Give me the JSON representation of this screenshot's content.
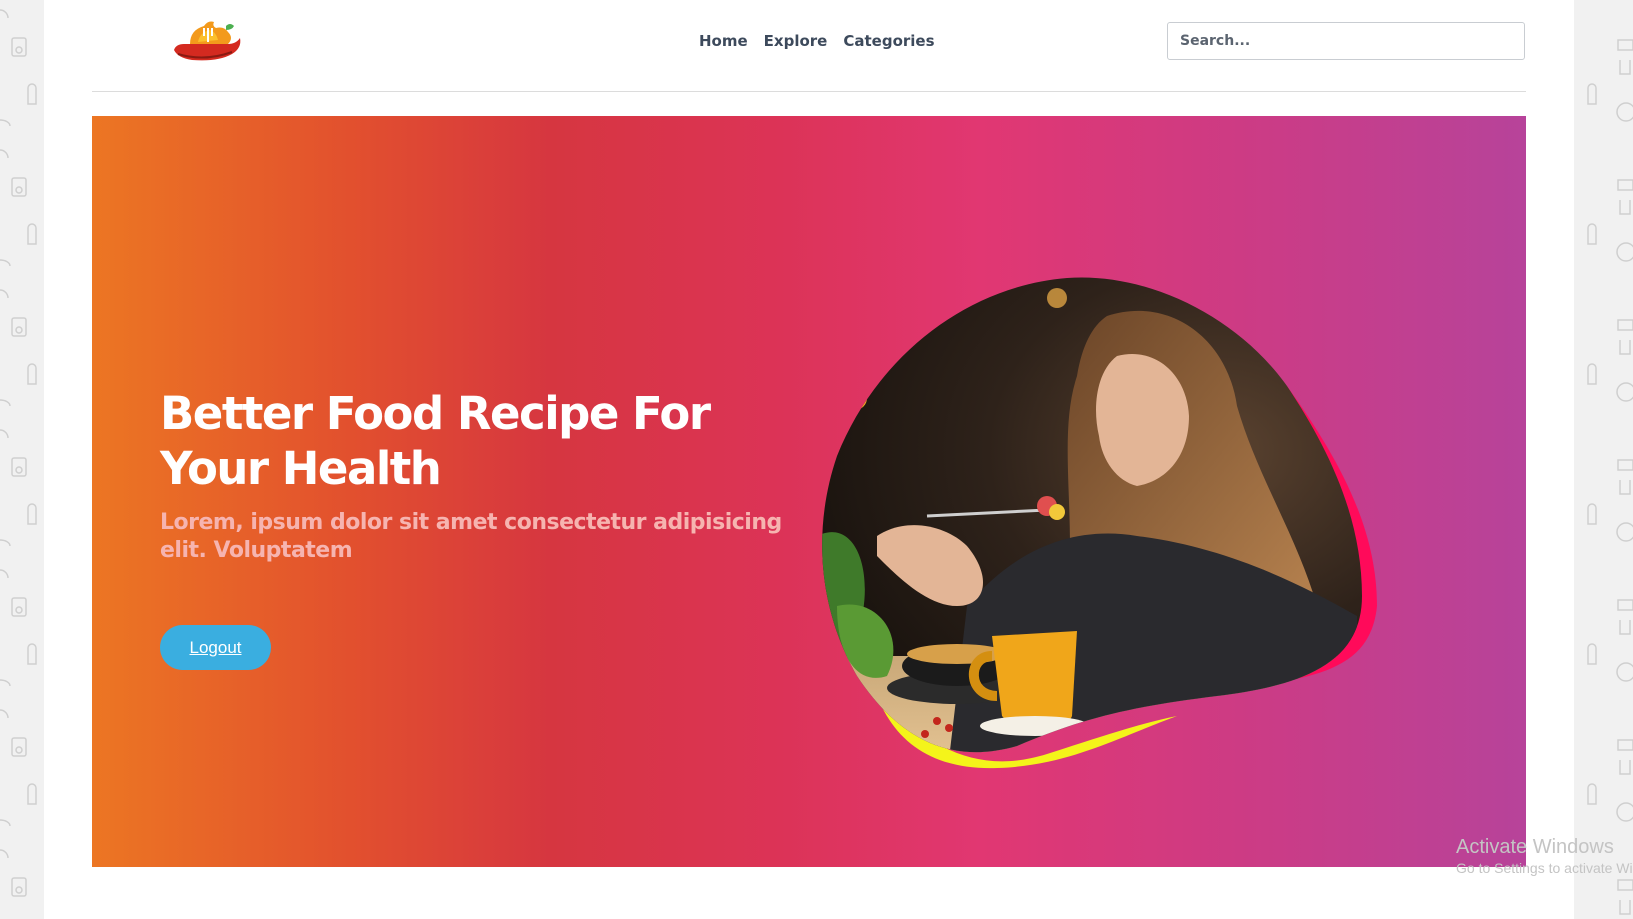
{
  "nav": {
    "items": [
      "Home",
      "Explore",
      "Categories"
    ]
  },
  "search": {
    "placeholder": "Search..."
  },
  "hero": {
    "title": "Better Food Recipe For Your Health",
    "subtitle": "Lorem, ipsum dolor sit amet consectetur adipisicing elit. Voluptatem",
    "button_label": "Logout",
    "gradient_colors": [
      "#ec7623",
      "#d63640",
      "#e13772",
      "#b7439a"
    ]
  },
  "logo": {
    "icon": "chili-fork-logo-icon"
  },
  "watermark": {
    "line1": "Activate Windows",
    "line2": "Go to Settings to activate Windows."
  }
}
